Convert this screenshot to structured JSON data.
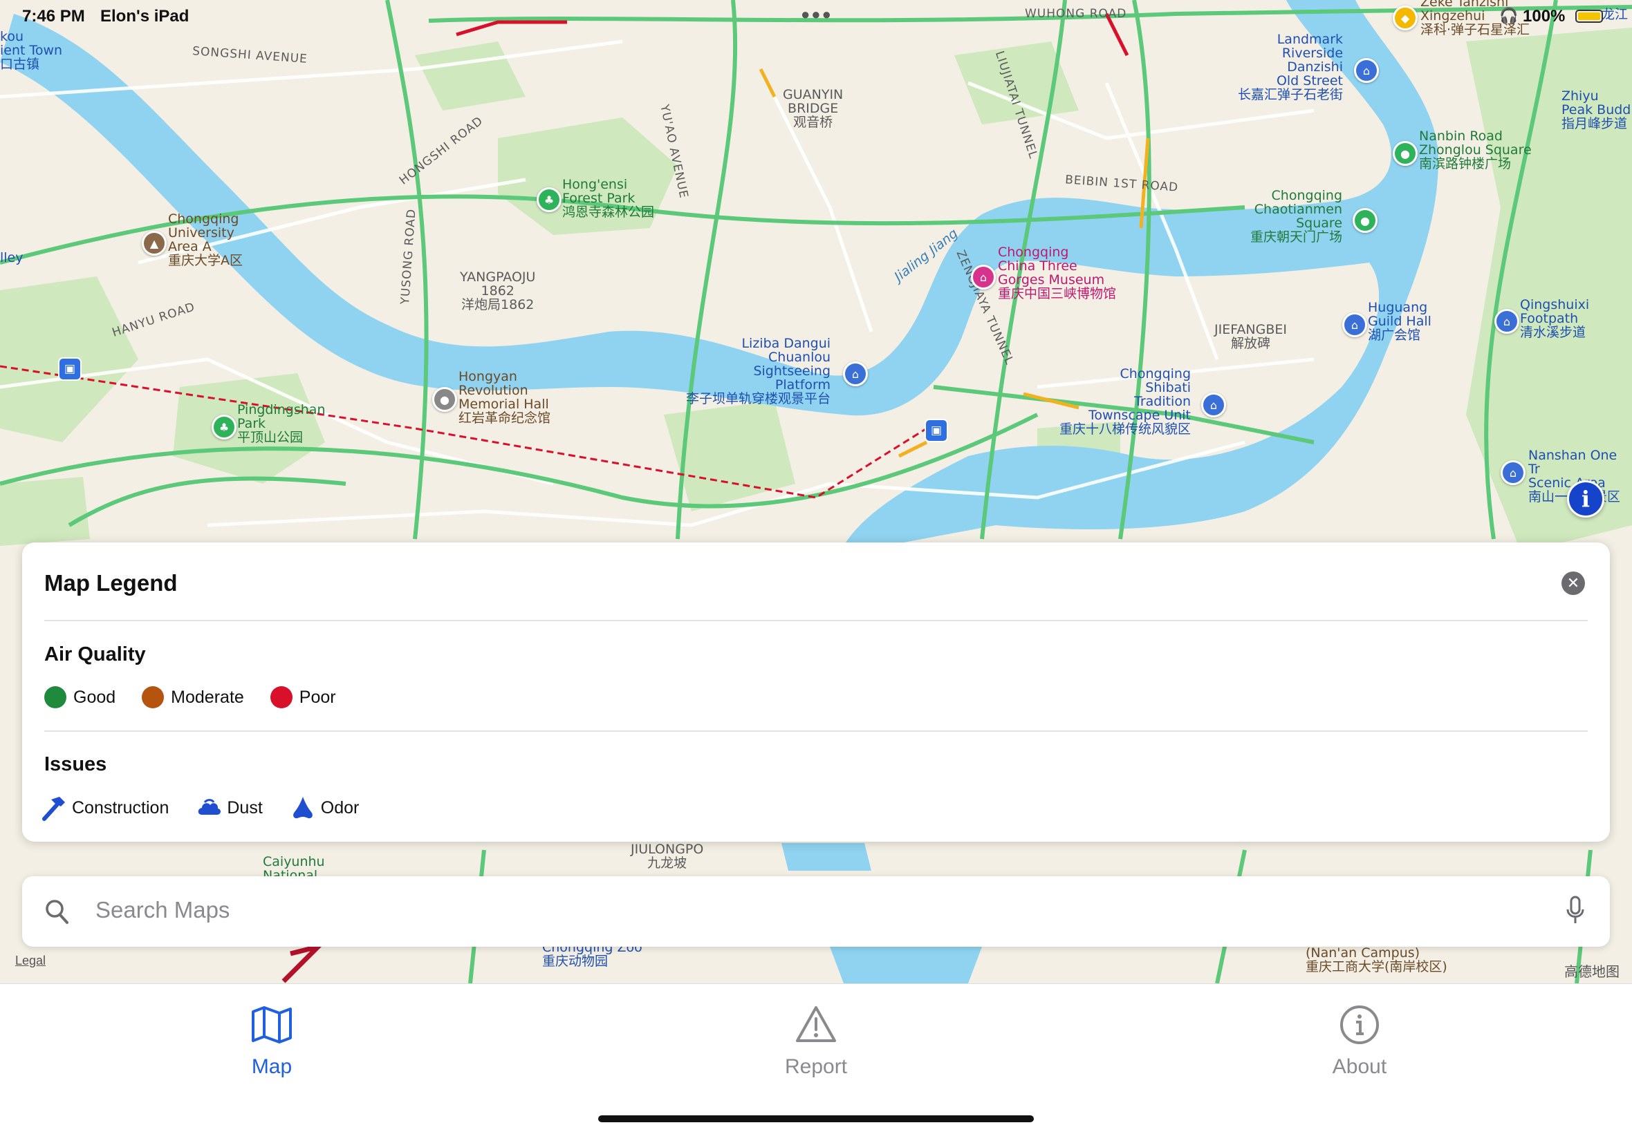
{
  "status_bar": {
    "time": "7:46 PM",
    "device": "Elon's iPad",
    "battery": "100%"
  },
  "map": {
    "labels": {
      "songshi_avenue": "SONGSHI AVENUE",
      "hongshi_road": "HONGSHI ROAD",
      "yuao_avenue": "YU'AO AVENUE",
      "guanyin_bridge": "GUANYIN\nBRIDGE\n观音桥",
      "liujiatai_tunnel": "LIUJIATAI TUNNEL",
      "wuhong_road": "WUHONG ROAD",
      "beibin_road": "BEIBIN 1ST ROAD",
      "hongensi": "Hong'ensi\nForest Park\n鸿恩寺森林公园",
      "chongqing_uni": "Chongqing\nUniversity\nArea A\n重庆大学A区",
      "yusong_road": "YUSONG ROAD",
      "yangpaoju": "YANGPAOJU\n1862\n洋炮局1862",
      "hanyu_road": "HANYU ROAD",
      "jialing_jiang": "Jialing Jiang",
      "zengjiaya_tunnel": "ZENGJIAYA TUNNEL",
      "three_gorges": "Chongqing\nChina Three\nGorges Museum\n重庆中国三峡博物馆",
      "landmark": "Landmark\nRiverside\nDanzishi\nOld Street\n长嘉汇弹子石老街",
      "zeke": "Zeke Tanzishi\nXingzehui\n泽科·弹子石星泽汇",
      "nanbin": "Nanbin Road\nZhonglou Square\n南滨路钟楼广场",
      "chaotianmen": "Chongqing\nChaotianmen\nSquare\n重庆朝天门广场",
      "jiefangbei": "JIEFANGBEI\n解放碑",
      "huguang": "Huguang\nGuild Hall\n湖广会馆",
      "qingshuixi": "Qingshuixi\nFootpath\n清水溪步道",
      "liziba": "Liziba Dangui\nChuanlou\nSightseeing\nPlatform\n李子坝单轨穿楼观景平台",
      "hongyan": "Hongyan\nRevolution\nMemorial Hall\n红岩革命纪念馆",
      "pingdingshan": "Pingdingshan\nPark\n平顶山公园",
      "shibati": "Chongqing\nShibati\nTradition\nTownscape Unit\n重庆十八梯传统风貌区",
      "nanshan": "Nanshan One Tr\nScenic Area\n南山一棵树景区",
      "ancient_town": "kou\nient Town\n口古镇",
      "zhiyu": "Zhiyu\nPeak Budd\n指月峰步道",
      "jiulongpo": "JIULONGPO\n九龙坡",
      "caiyunhu": "Caiyunhu\nNational",
      "zoo": "Chongqing Zoo\n重庆动物园",
      "nanan": "(Nan'an Campus)\n重庆工商大学(南岸校区)",
      "longjiang": "龙江",
      "valley": "lley"
    }
  },
  "legend": {
    "title": "Map Legend",
    "air_quality": {
      "title": "Air Quality",
      "items": [
        {
          "label": "Good",
          "color": "#1f8a3b"
        },
        {
          "label": "Moderate",
          "color": "#b4540f"
        },
        {
          "label": "Poor",
          "color": "#d8102a"
        }
      ]
    },
    "issues": {
      "title": "Issues",
      "items": [
        {
          "label": "Construction",
          "icon": "hammer-icon"
        },
        {
          "label": "Dust",
          "icon": "cloud-icon"
        },
        {
          "label": "Odor",
          "icon": "nose-icon"
        }
      ]
    }
  },
  "search": {
    "placeholder": "Search Maps"
  },
  "map_footer": {
    "legal": "Legal",
    "attribution": "高德地图"
  },
  "tabs": [
    {
      "label": "Map",
      "icon": "map-icon",
      "active": true
    },
    {
      "label": "Report",
      "icon": "warning-icon",
      "active": false
    },
    {
      "label": "About",
      "icon": "info-icon",
      "active": false
    }
  ],
  "colors": {
    "accent": "#1f5fe0",
    "water": "#8fd3f0",
    "park": "#cfe8bd"
  }
}
